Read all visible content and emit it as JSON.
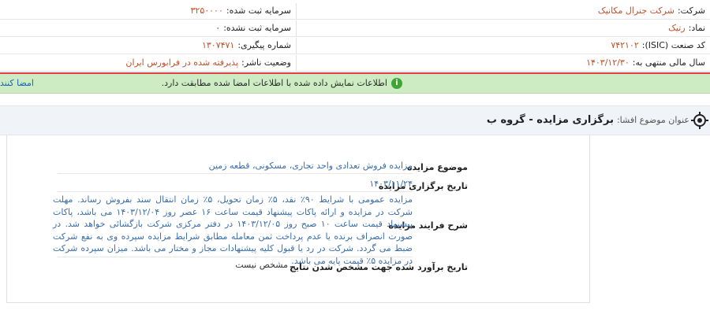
{
  "company_info": {
    "company_label": "شرکت:",
    "company_value": "شرکت جنرال مکانیک",
    "symbol_label": "نماد:",
    "symbol_value": "رتیک",
    "isic_label": "کد صنعت (ISIC):",
    "isic_value": "۷۴۲۱۰۲",
    "fiscal_year_label": "سال مالی منتهی به:",
    "fiscal_year_value": "۱۴۰۳/۱۲/۳۰",
    "registered_capital_label": "سرمایه ثبت شده:",
    "registered_capital_value": "۳۲۵۰۰۰۰",
    "unregistered_capital_label": "سرمایه ثبت نشده:",
    "unregistered_capital_value": "۰",
    "tracking_label": "شماره پیگیری:",
    "tracking_value": "۱۳۰۷۴۷۱",
    "publisher_status_label": "وضعیت ناشر:",
    "publisher_status_value": "پذیرفته شده در فرابورس ایران"
  },
  "alert": {
    "icon": "info-icon",
    "message": "اطلاعات نمایش داده شده با اطلاعات امضا شده مطابقت دارد.",
    "link": "امضا کنند"
  },
  "subject": {
    "label": "عنوان موضوع افشا:",
    "title": "برگزاری مزایده - گروه ب"
  },
  "details": {
    "topic_label": "موضوع مزایده",
    "topic_value": "مزایده فروش تعدادی واحد تجاری، مسکونی، قطعه زمین",
    "date_label": "تاریخ برگزاری مزایده",
    "date_value": "۱۴۰۳/۱۱/۲۴",
    "process_label": "شرح فرایند مزایده",
    "process_value": "مزایده عمومی با شرایط ۹۰٪ نقد، ۵٪ زمان تحویل، ۵٪ زمان انتقال سند بفروش رساند. مهلت شرکت در مزایده و ارائه پاکات پیشنهاد قیمت ساعت ۱۶ عصر روز ۱۴۰۳/۱۲/۰۴ می باشد، پاکات پیشنهاد قیمت ساعت ۱۰ صبح روز ۱۴۰۳/۱۲/۰۵ در دفتر مرکزی شرکت بازگشائی خواهد شد. در صورت انصراف برنده یا عدم پرداخت ثمن معامله مطابق شرایط مزایده سپرده وی به نفع شرکت ضبط می گردد. شرکت در رد یا قبول کلیه پیشنهادات مجاز و مختار می باشد. میزان سپرده شرکت در مزایده ۵٪ قیمت پایه می باشد.",
    "results_label": "تاریخ برآورد شده جهت مشخص شدن نتایج",
    "results_value": "مشخص نیست"
  },
  "colors": {
    "accent_value": "#c0502a",
    "alert_bg": "#cdecc3",
    "detail_text": "#3b6ea8",
    "red_rule": "#e04040"
  }
}
